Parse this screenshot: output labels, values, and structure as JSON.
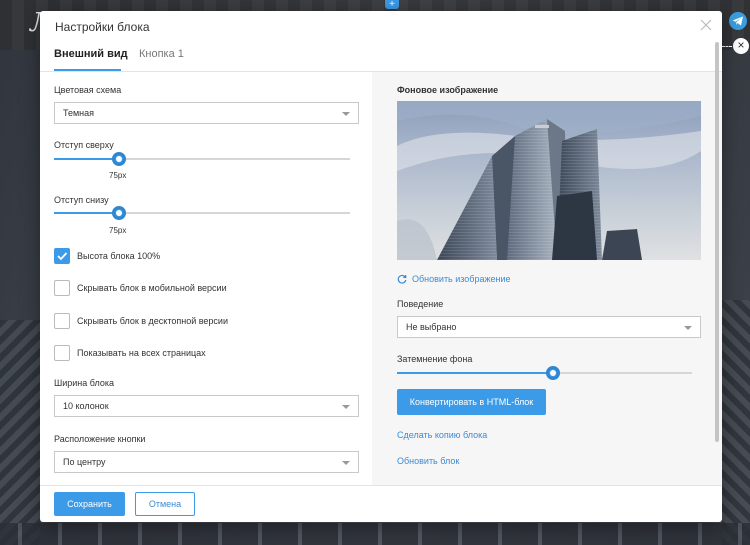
{
  "modal": {
    "title": "Настройки блока",
    "tabs": [
      {
        "label": "Внешний вид",
        "active": true
      },
      {
        "label": "Кнопка 1",
        "active": false
      }
    ]
  },
  "left": {
    "color_scheme": {
      "label": "Цветовая схема",
      "value": "Темная"
    },
    "padding_top": {
      "label": "Отступ сверху",
      "value_text": "75px",
      "level": 0.22
    },
    "padding_bottom": {
      "label": "Отступ снизу",
      "value_text": "75px",
      "level": 0.22
    },
    "checkboxes": [
      {
        "label": "Высота блока 100%",
        "checked": true
      },
      {
        "label": "Скрывать блок в мобильной версии",
        "checked": false
      },
      {
        "label": "Скрывать блок в десктопной версии",
        "checked": false
      },
      {
        "label": "Показывать на всех страницах",
        "checked": false
      }
    ],
    "block_width": {
      "label": "Ширина блока",
      "value": "10 колонок"
    },
    "button_position": {
      "label": "Расположение кнопки",
      "value": "По центру"
    }
  },
  "right": {
    "bg_image_label": "Фоновое изображение",
    "update_image_link": "Обновить изображение",
    "behavior": {
      "label": "Поведение",
      "value": "Не выбрано"
    },
    "darkening": {
      "label": "Затемнение фона",
      "level": 0.53
    },
    "convert_button": "Конвертировать в HTML-блок",
    "copy_link": "Сделать копию блока",
    "refresh_link": "Обновить блок"
  },
  "footer": {
    "save_label": "Сохранить",
    "cancel_label": "Отмена"
  },
  "colors": {
    "accent": "#3c9be8",
    "link": "#3c8ad6"
  }
}
